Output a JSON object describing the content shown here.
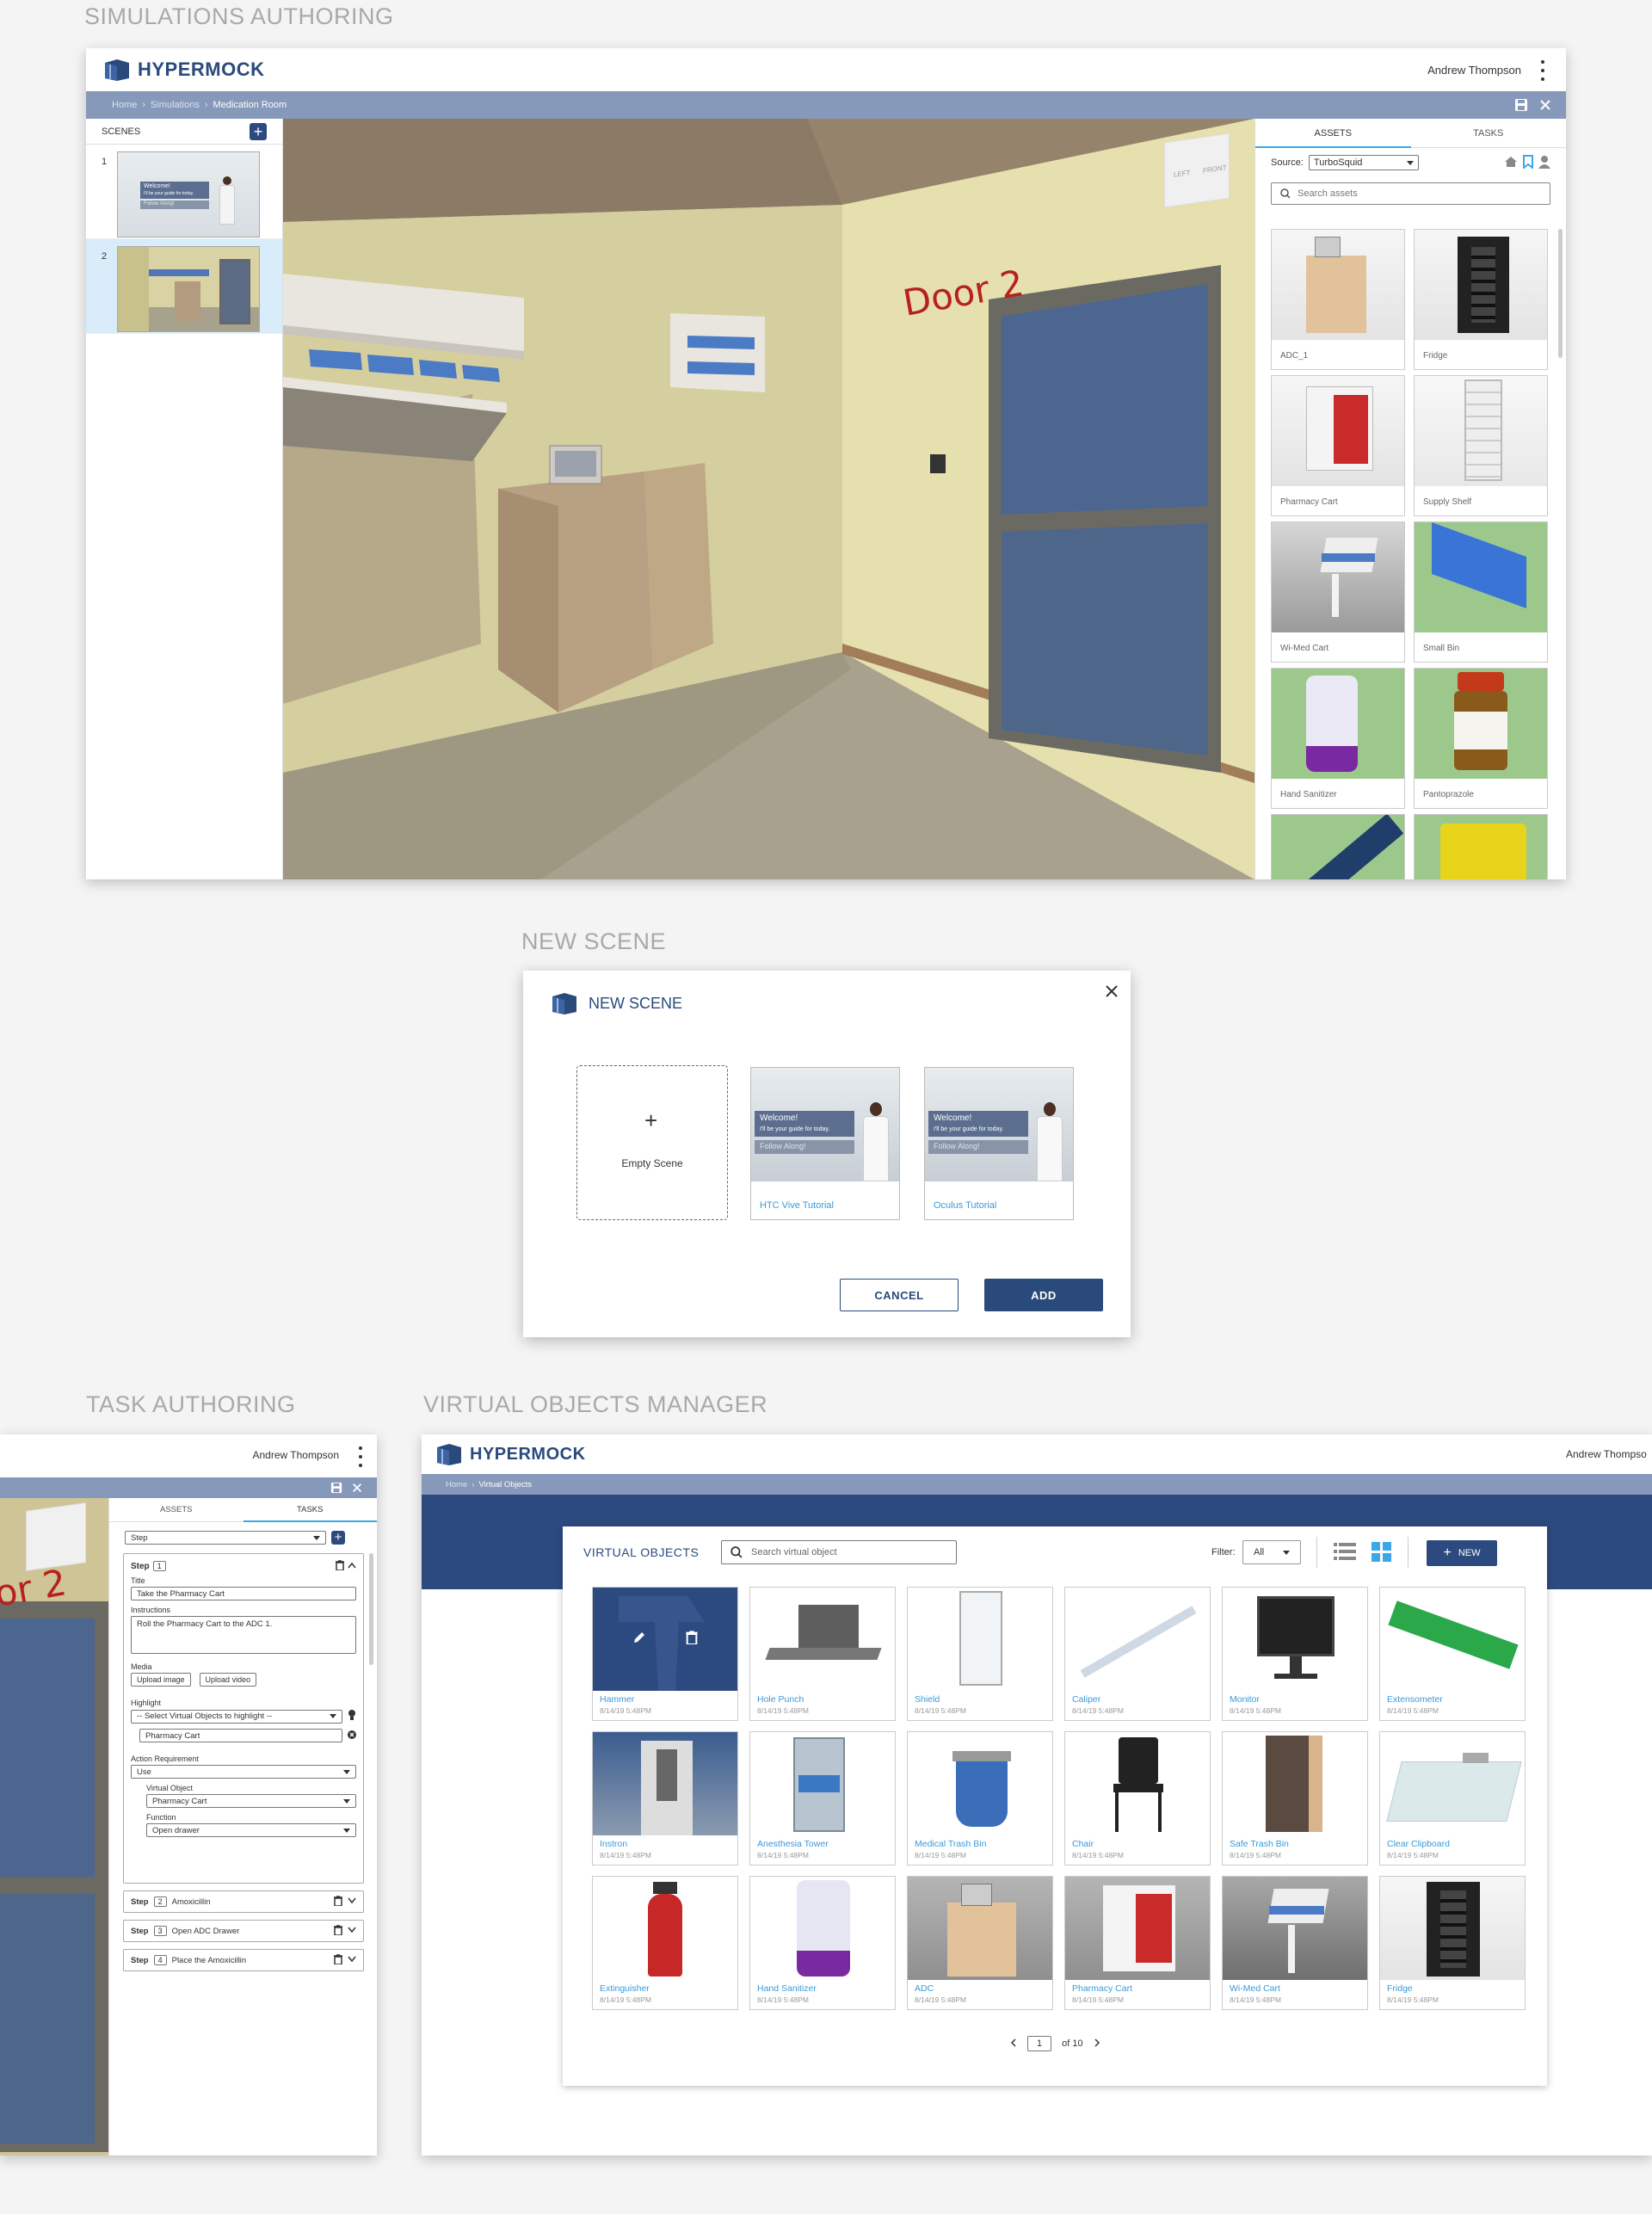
{
  "sections": {
    "simulations": "SIMULATIONS AUTHORING",
    "new_scene": "NEW SCENE",
    "task": "TASK AUTHORING",
    "vom": "VIRTUAL OBJECTS MANAGER"
  },
  "app": {
    "name": "HYPERMOCK",
    "user": "Andrew Thompson"
  },
  "sim": {
    "breadcrumb": [
      "Home",
      "Simulations",
      "Medication Room"
    ],
    "scenes_label": "SCENES",
    "scenes": [
      {
        "num": "1",
        "welcome": "Welcome!",
        "sub": "I'll be your guide for today.",
        "follow": "Follow Along!"
      },
      {
        "num": "2"
      }
    ],
    "viewport": {
      "door_label": "Door 2",
      "cube_left": "LEFT",
      "cube_front": "FRONT"
    },
    "tabs": [
      "ASSETS",
      "TASKS"
    ],
    "source_label": "Source:",
    "source_value": "TurboSquid",
    "search_placeholder": "Search assets",
    "assets": [
      "ADC_1",
      "Fridge",
      "Pharmacy Cart",
      "Supply Shelf",
      "Wi-Med Cart",
      "Small Bin",
      "Hand Sanitizer",
      "Pantoprazole"
    ]
  },
  "modal": {
    "title": "NEW SCENE",
    "empty": "Empty Scene",
    "templates": [
      {
        "label": "HTC Vive Tutorial",
        "welcome": "Welcome!",
        "sub": "I'll be your guide for today.",
        "follow": "Follow Along!"
      },
      {
        "label": "Oculus Tutorial",
        "welcome": "Welcome!",
        "sub": "I'll be your guide for today.",
        "follow": "Follow Along!"
      }
    ],
    "cancel": "CANCEL",
    "add": "ADD"
  },
  "task": {
    "user": "Andrew Thompson",
    "door_label": "or 2",
    "tabs": [
      "ASSETS",
      "TASKS"
    ],
    "type_select": "Step",
    "step1": {
      "step_label": "Step",
      "num": "1",
      "title_label": "Title",
      "title_value": "Take the Pharmacy Cart",
      "instructions_label": "Instructions",
      "instructions_value": "Roll the Pharmacy Cart to the ADC 1.",
      "media_label": "Media",
      "upload_image": "Upload image",
      "upload_video": "Upload video",
      "highlight_label": "Highlight",
      "highlight_select": "-- Select Virtual Objects to highlight --",
      "highlight_item": "Pharmacy Cart",
      "action_label": "Action Requirement",
      "action_value": "Use",
      "vo_label": "Virtual Object",
      "vo_value": "Pharmacy Cart",
      "function_label": "Function",
      "function_value": "Open drawer"
    },
    "steps": [
      {
        "label": "Step",
        "num": "2",
        "title": "Amoxicillin"
      },
      {
        "label": "Step",
        "num": "3",
        "title": "Open ADC Drawer"
      },
      {
        "label": "Step",
        "num": "4",
        "title": "Place the Amoxicillin"
      }
    ]
  },
  "vom": {
    "user": "Andrew Thompso",
    "breadcrumb": [
      "Home",
      "Virtual Objects"
    ],
    "title": "VIRTUAL OBJECTS",
    "search_placeholder": "Search virtual object",
    "filter_label": "Filter:",
    "filter_value": "All",
    "new_label": "NEW",
    "objects": [
      {
        "name": "Hammer",
        "date": "8/14/19 5:48PM"
      },
      {
        "name": "Hole Punch",
        "date": "8/14/19 5:48PM"
      },
      {
        "name": "Shield",
        "date": "8/14/19 5:48PM"
      },
      {
        "name": "Caliper",
        "date": "8/14/19 5:48PM"
      },
      {
        "name": "Monitor",
        "date": "8/14/19 5:48PM"
      },
      {
        "name": "Extensometer",
        "date": "8/14/19 5:48PM"
      },
      {
        "name": "Instron",
        "date": "8/14/19 5:48PM"
      },
      {
        "name": "Anesthesia Tower",
        "date": "8/14/19 5:48PM"
      },
      {
        "name": "Medical Trash Bin",
        "date": "8/14/19 5:48PM"
      },
      {
        "name": "Chair",
        "date": "8/14/19 5:48PM"
      },
      {
        "name": "Safe Trash Bin",
        "date": "8/14/19 5:48PM"
      },
      {
        "name": "Clear Clipboard",
        "date": "8/14/19 5:48PM"
      },
      {
        "name": "Extinguisher",
        "date": "8/14/19 5:48PM"
      },
      {
        "name": "Hand Sanitizer",
        "date": "8/14/19 5:48PM"
      },
      {
        "name": "ADC",
        "date": "8/14/19 5:48PM"
      },
      {
        "name": "Pharmacy Cart",
        "date": "8/14/19 5:48PM"
      },
      {
        "name": "Wi-Med Cart",
        "date": "8/14/19 5:48PM"
      },
      {
        "name": "Fridge",
        "date": "8/14/19 5:48PM"
      }
    ],
    "page": "1",
    "page_of": "of 10"
  },
  "colors": {
    "brand": "#2a4a7c",
    "breadcrumb": "#8699ba",
    "accent": "#3aa7e8",
    "link": "#3a9ad9"
  }
}
